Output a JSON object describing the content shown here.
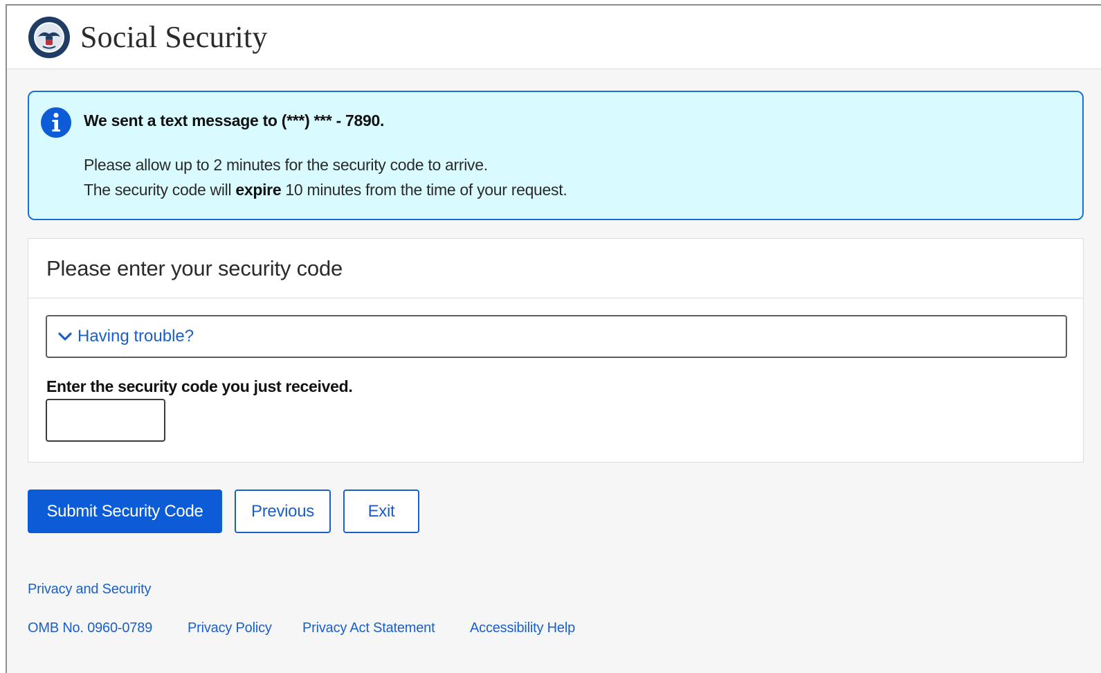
{
  "header": {
    "brand": "Social Security",
    "logo_icon": "ssa-seal-icon"
  },
  "alert": {
    "icon": "info-icon",
    "title": "We sent a text message to (***) *** - 7890.",
    "line1": "Please allow up to 2 minutes for the security code to arrive.",
    "line2_before": "The security code will ",
    "line2_bold": "expire",
    "line2_after": " 10 minutes from the time of your request.",
    "bg_color": "#d9fbff",
    "border_color": "#1a6fd6"
  },
  "card": {
    "title": "Please enter your security code",
    "trouble_label": "Having trouble?",
    "trouble_icon": "chevron-down-icon",
    "code_label": "Enter the security code you just received.",
    "code_value": ""
  },
  "buttons": {
    "submit": "Submit Security Code",
    "previous": "Previous",
    "exit": "Exit",
    "primary_color": "#0b5cd6"
  },
  "footer": {
    "privacy_security": "Privacy and Security",
    "omb": "OMB No. 0960-0789",
    "privacy_policy": "Privacy Policy",
    "privacy_act": "Privacy Act Statement",
    "accessibility": "Accessibility Help"
  }
}
